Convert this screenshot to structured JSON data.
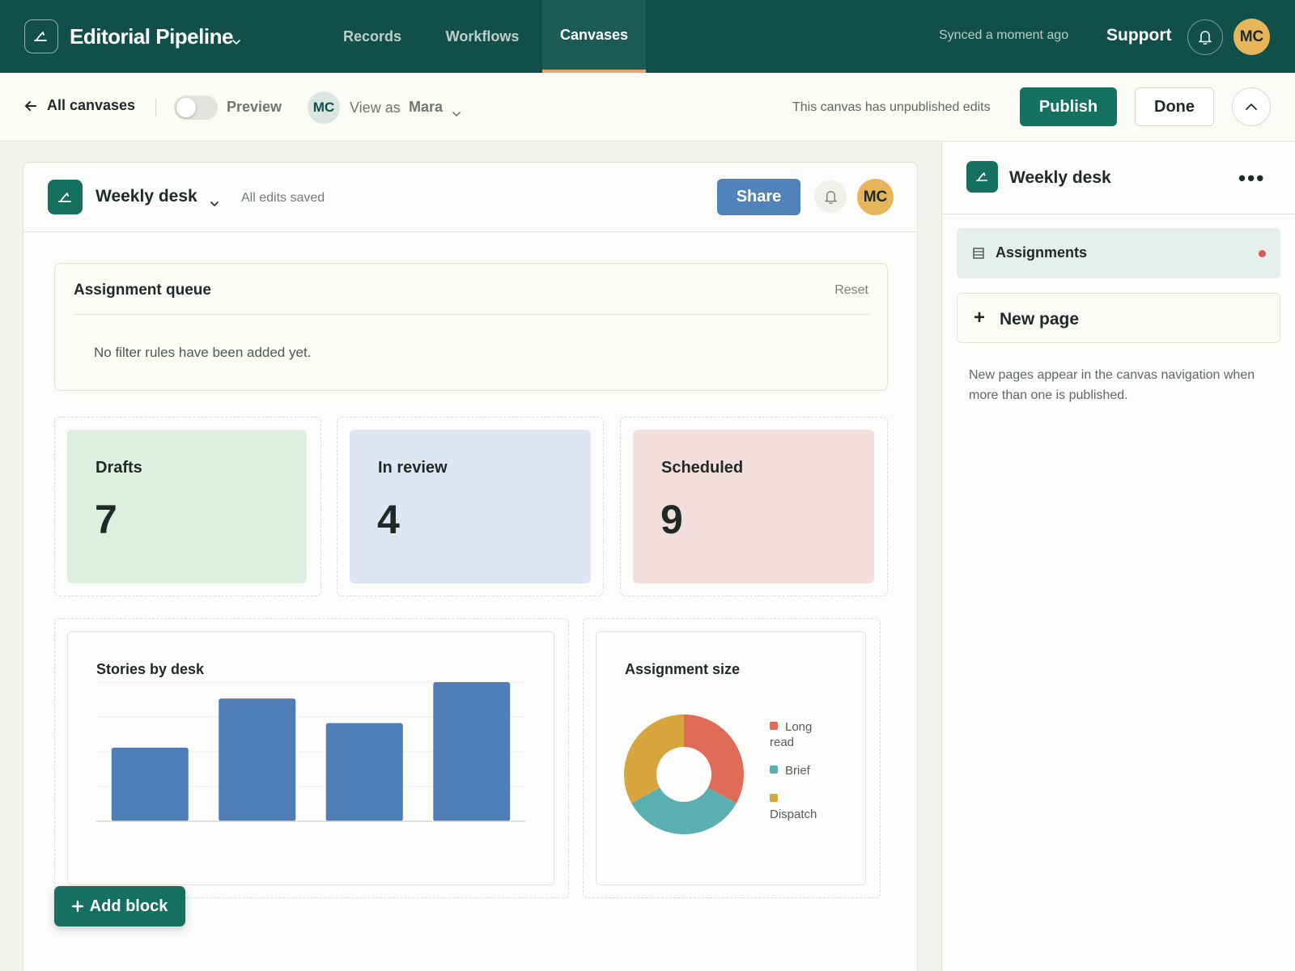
{
  "app": {
    "title": "Editorial Pipeline",
    "nav_tabs": [
      "Records",
      "Workflows",
      "Canvases"
    ],
    "active_tab": "Canvases",
    "sync_status": "Synced a moment ago",
    "support_label": "Support",
    "user_initials": "MC",
    "colors": {
      "header_bg": "#11504a",
      "accent": "#167060",
      "active_tab_underline": "#e8a56d",
      "avatar_bg": "#e8b65a"
    }
  },
  "toolbar": {
    "back_label": "All canvases",
    "preview_label": "Preview",
    "preview_on": false,
    "view_as_initials": "MC",
    "view_as_label": "View as",
    "view_as_name": "Mara",
    "unpublished_notice": "This canvas has unpublished edits",
    "publish_label": "Publish",
    "done_label": "Done"
  },
  "canvas": {
    "title": "Weekly desk",
    "save_status": "All edits saved",
    "share_label": "Share",
    "user_initials": "MC",
    "queue": {
      "title": "Assignment queue",
      "reset_label": "Reset",
      "empty_text": "No filter rules have been added yet."
    },
    "stats": [
      {
        "label": "Drafts",
        "value": "7",
        "color": "#ddefdf"
      },
      {
        "label": "In review",
        "value": "4",
        "color": "#dde7f3"
      },
      {
        "label": "Scheduled",
        "value": "9",
        "color": "#f2dfdc"
      }
    ],
    "add_block_label": "Add block"
  },
  "chart_data": [
    {
      "type": "bar",
      "title": "Stories by desk",
      "categories": [
        "",
        "",
        "",
        ""
      ],
      "values": [
        9,
        15,
        12,
        17
      ],
      "ylim": [
        0,
        17
      ],
      "grid": true,
      "color": "#4f7db5"
    },
    {
      "type": "pie",
      "title": "Assignment size",
      "donut": true,
      "labels": [
        "Long read",
        "Brief",
        "Dispatch"
      ],
      "values": [
        33,
        34,
        33
      ],
      "colors": [
        "#e06b57",
        "#5aafb0",
        "#d9a63e"
      ],
      "legend": "right"
    }
  ],
  "side_panel": {
    "title": "Weekly desk",
    "pages": [
      {
        "label": "Assignments",
        "has_unpublished_dot": true
      }
    ],
    "new_page_label": "New page",
    "note": "New pages appear in the canvas navigation when more than one is published."
  }
}
